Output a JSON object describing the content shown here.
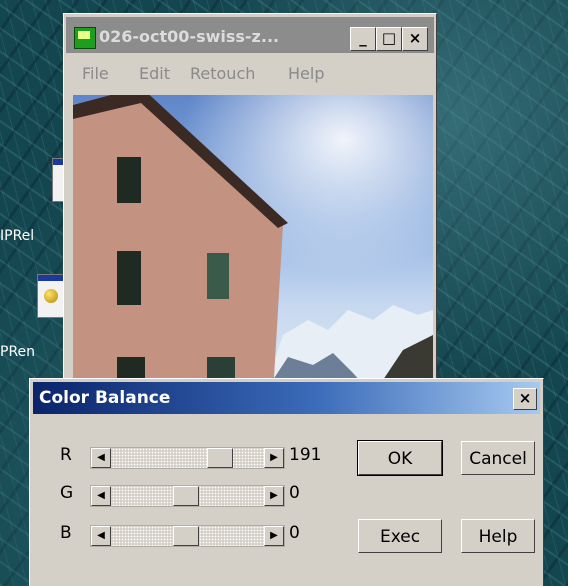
{
  "desktop": {
    "icons": [
      {
        "label": "IPRel"
      },
      {
        "label": "PRen"
      }
    ]
  },
  "image_window": {
    "title": "026-oct00-swiss-z...",
    "controls": {
      "minimize": "_",
      "maximize": "□",
      "close": "×"
    },
    "menu": [
      "File",
      "Edit",
      "Retouch",
      "Help"
    ]
  },
  "color_balance": {
    "title": "Color Balance",
    "close": "×",
    "sliders": [
      {
        "label": "R",
        "value": "191",
        "level": 191,
        "max": 255
      },
      {
        "label": "G",
        "value": "0",
        "level": 0
      },
      {
        "label": "B",
        "value": "0",
        "level": 0
      }
    ],
    "buttons": {
      "ok": "OK",
      "cancel": "Cancel",
      "exec": "Exec",
      "help": "Help"
    },
    "arrow_left": "◀",
    "arrow_right": "▶"
  },
  "colors": {
    "title_active": "#0a246a",
    "title_inactive": "#8c8c8c",
    "face": "#d4d0c8"
  }
}
